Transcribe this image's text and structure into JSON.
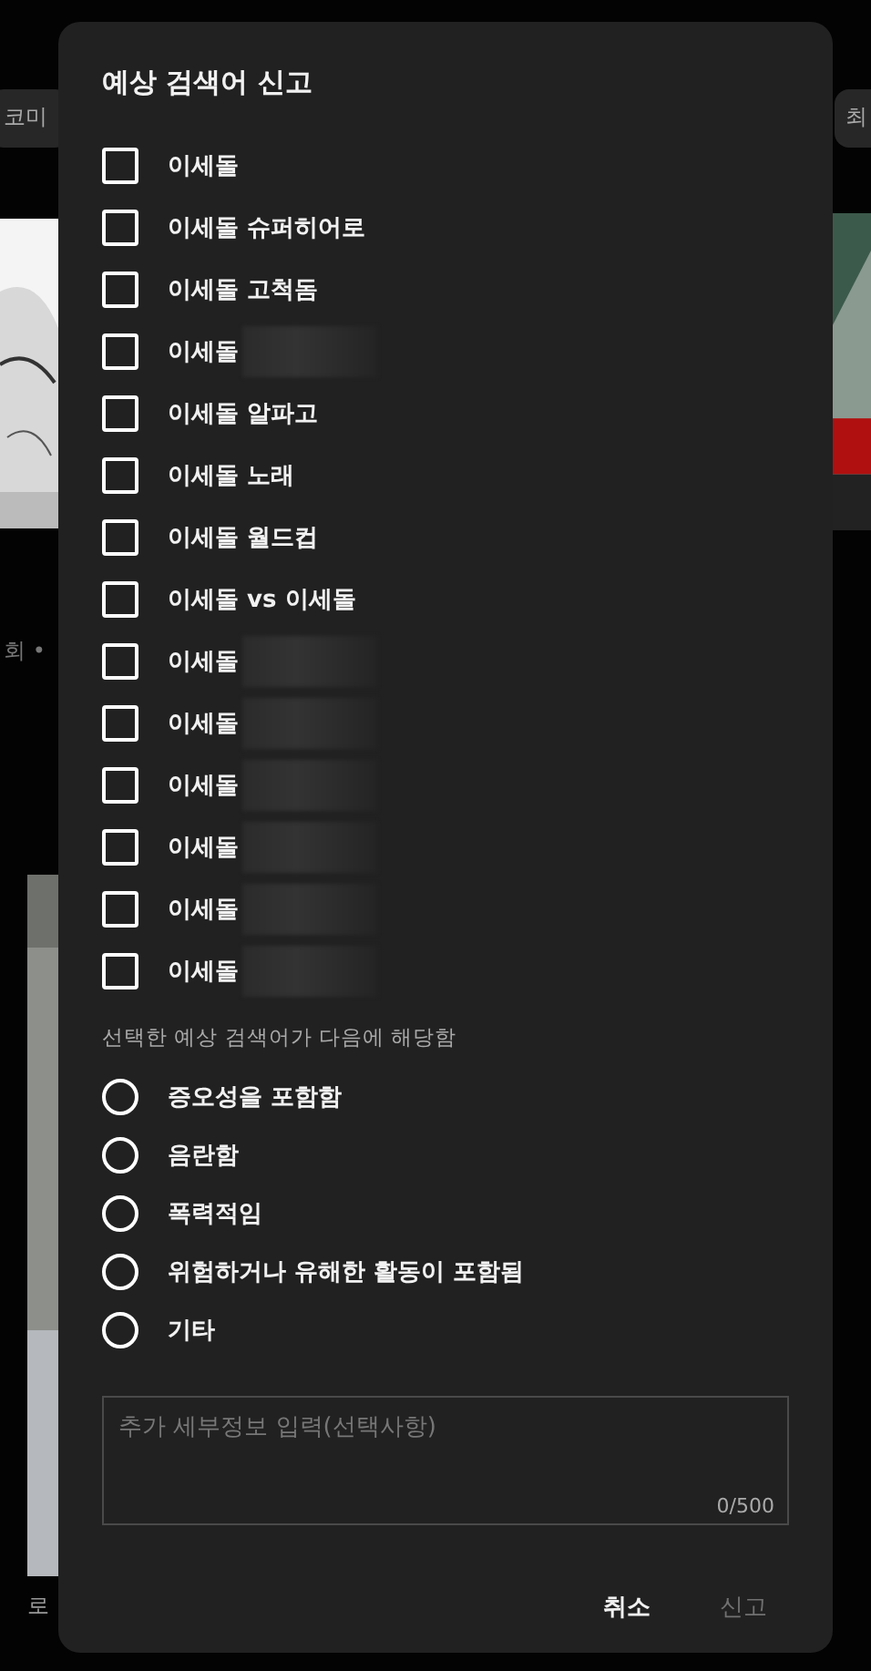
{
  "background": {
    "chips": [
      {
        "label": "코미"
      },
      {
        "label": "최"
      }
    ],
    "texts": [
      {
        "label": "회 •"
      },
      {
        "label": "로"
      }
    ]
  },
  "dialog": {
    "title": "예상 검색어 신고",
    "suggestions": [
      {
        "label": "이세돌",
        "checked": false,
        "redacted": false
      },
      {
        "label": "이세돌 슈퍼히어로",
        "checked": false,
        "redacted": false
      },
      {
        "label": "이세돌 고척돔",
        "checked": false,
        "redacted": false
      },
      {
        "label": "이세돌",
        "checked": false,
        "redacted": true
      },
      {
        "label": "이세돌 알파고",
        "checked": false,
        "redacted": false
      },
      {
        "label": "이세돌 노래",
        "checked": false,
        "redacted": false
      },
      {
        "label": "이세돌 월드컵",
        "checked": false,
        "redacted": false
      },
      {
        "label": "이세돌 vs 이세돌",
        "checked": false,
        "redacted": false
      },
      {
        "label": "이세돌",
        "checked": false,
        "redacted": true
      },
      {
        "label": "이세돌",
        "checked": false,
        "redacted": true
      },
      {
        "label": "이세돌",
        "checked": false,
        "redacted": true
      },
      {
        "label": "이세돌",
        "checked": false,
        "redacted": true
      },
      {
        "label": "이세돌",
        "checked": false,
        "redacted": true
      },
      {
        "label": "이세돌",
        "checked": false,
        "redacted": true
      }
    ],
    "reasons_heading": "선택한 예상 검색어가 다음에 해당함",
    "reasons": [
      {
        "label": "증오성을 포함함",
        "selected": false
      },
      {
        "label": "음란함",
        "selected": false
      },
      {
        "label": "폭력적임",
        "selected": false
      },
      {
        "label": "위험하거나 유해한 활동이 포함됨",
        "selected": false
      },
      {
        "label": "기타",
        "selected": false
      }
    ],
    "details": {
      "placeholder": "추가 세부정보 입력(선택사항)",
      "counter": "0/500"
    },
    "buttons": [
      {
        "label": "취소",
        "disabled": false
      },
      {
        "label": "신고",
        "disabled": true
      }
    ]
  }
}
